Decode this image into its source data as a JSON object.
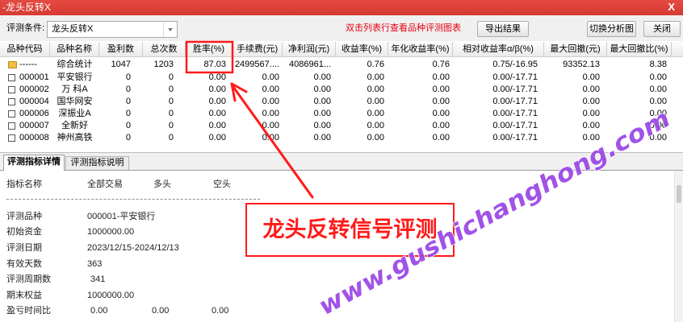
{
  "window": {
    "title": "-龙头反转X",
    "close_glyph": "X"
  },
  "toolbar": {
    "condition_label": "评测条件:",
    "condition_value": "龙头反转X",
    "hint": "双击列表行查看品种评测图表",
    "export_button": "导出结果",
    "switch_button": "切换分析图",
    "close_button": "关闭"
  },
  "table": {
    "columns": [
      "品种代码",
      "品种名称",
      "盈利数",
      "总次数",
      "胜率(%)",
      "手续费(元)",
      "净利润(元)",
      "收益率(%)",
      "年化收益率(%)",
      "相对收益率α/β(%)",
      "最大回撤(元)",
      "最大回撤比(%)"
    ],
    "rows": [
      {
        "icon": "folder-icon",
        "cells": [
          "------",
          "综合统计",
          "1047",
          "1203",
          "87.03",
          "2499567....",
          "4086961...",
          "0.76",
          "0.76",
          "0.75/-16.95",
          "93352.13",
          "8.38"
        ]
      },
      {
        "icon": "checkbox-icon",
        "cells": [
          "000001",
          "平安银行",
          "0",
          "0",
          "0.00",
          "0.00",
          "0.00",
          "0.00",
          "0.00",
          "0.00/-17.71",
          "0.00",
          "0.00"
        ]
      },
      {
        "icon": "checkbox-icon",
        "cells": [
          "000002",
          "万 科A",
          "0",
          "0",
          "0.00",
          "0.00",
          "0.00",
          "0.00",
          "0.00",
          "0.00/-17.71",
          "0.00",
          "0.00"
        ]
      },
      {
        "icon": "checkbox-icon",
        "cells": [
          "000004",
          "国华网安",
          "0",
          "0",
          "0.00",
          "0.00",
          "0.00",
          "0.00",
          "0.00",
          "0.00/-17.71",
          "0.00",
          "0.00"
        ]
      },
      {
        "icon": "checkbox-icon",
        "cells": [
          "000006",
          "深振业A",
          "0",
          "0",
          "0.00",
          "0.00",
          "0.00",
          "0.00",
          "0.00",
          "0.00/-17.71",
          "0.00",
          "0.00"
        ]
      },
      {
        "icon": "checkbox-icon",
        "cells": [
          "000007",
          "全新好",
          "0",
          "0",
          "0.00",
          "0.00",
          "0.00",
          "0.00",
          "0.00",
          "0.00/-17.71",
          "0.00",
          "0.00"
        ]
      },
      {
        "icon": "checkbox-icon",
        "cells": [
          "000008",
          "神州高铁",
          "0",
          "0",
          "0.00",
          "0.00",
          "0.00",
          "0.00",
          "0.00",
          "0.00/-17.71",
          "0.00",
          "0.00"
        ]
      }
    ]
  },
  "tabs": [
    {
      "label": "评测指标详情",
      "active": true
    },
    {
      "label": "评测指标说明",
      "active": false
    }
  ],
  "detail": {
    "header": [
      "指标名称",
      "全部交易",
      "多头",
      "空头"
    ],
    "rows": [
      [
        "评测品种",
        "000001-平安银行"
      ],
      [
        "初始资金",
        "1000000.00"
      ],
      [
        "评测日期",
        "2023/12/15-2024/12/13"
      ],
      [
        "有效天数",
        "363"
      ],
      [
        "评测周期数",
        "341"
      ],
      [
        "期末权益",
        "1000000.00"
      ],
      [
        "盈亏时间比",
        "0.00",
        "0.00",
        "0.00"
      ]
    ]
  },
  "annotation": {
    "text": "龙头反转信号评测"
  },
  "watermark": {
    "text": "www.gushichanghong.com"
  },
  "colors": {
    "title_bar": "#d63a33",
    "hint_text": "#e60012",
    "annotation_red": "#ff1a1a",
    "watermark": "#9a44e6"
  },
  "icons": {
    "dropdown": "chevron-down-icon",
    "window_close": "close-window-icon"
  }
}
